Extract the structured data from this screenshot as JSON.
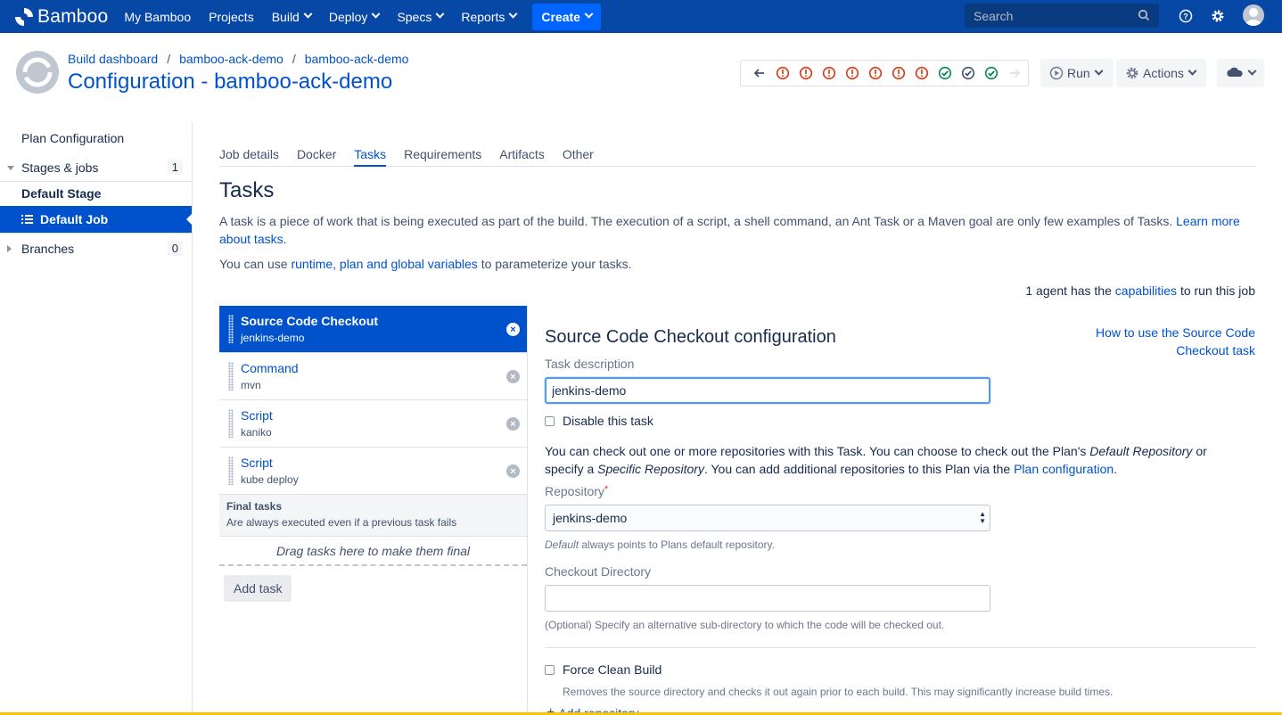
{
  "topnav": {
    "brand": "Bamboo",
    "items": [
      "My Bamboo",
      "Projects",
      "Build",
      "Deploy",
      "Specs",
      "Reports"
    ],
    "create_label": "Create",
    "search_placeholder": "Search",
    "bar_color": "#0747a6"
  },
  "header": {
    "breadcrumb": [
      "Build dashboard",
      "bamboo-ack-demo",
      "bamboo-ack-demo"
    ],
    "title": "Configuration - bamboo-ack-demo",
    "history": [
      "failed",
      "failed",
      "failed",
      "failed",
      "failed",
      "failed",
      "failed",
      "success",
      "success",
      "success"
    ],
    "run_label": "Run",
    "actions_label": "Actions"
  },
  "sidebar": {
    "plan_configuration": "Plan Configuration",
    "stages_label": "Stages & jobs",
    "stages_count": "1",
    "default_stage": "Default Stage",
    "default_job": "Default Job",
    "branches_label": "Branches",
    "branches_count": "0"
  },
  "tabs": [
    "Job details",
    "Docker",
    "Tasks",
    "Requirements",
    "Artifacts",
    "Other"
  ],
  "main": {
    "title": "Tasks",
    "intro": "A task is a piece of work that is being executed as part of the build. The execution of a script, a shell command, an Ant Task or a Maven goal are only few examples of Tasks.",
    "learn_more": "Learn more about tasks.",
    "vars_prefix": "You can use",
    "vars_link": "runtime, plan and global variables",
    "vars_suffix": "to parameterize your tasks.",
    "agent_prefix": "1 agent has the",
    "agent_link": "capabilities",
    "agent_suffix": "to run this job"
  },
  "tasks": [
    {
      "name": "Source Code Checkout",
      "desc": "jenkins-demo"
    },
    {
      "name": "Command",
      "desc": "mvn"
    },
    {
      "name": "Script",
      "desc": "kaniko"
    },
    {
      "name": "Script",
      "desc": "kube deploy"
    }
  ],
  "final_tasks": {
    "title": "Final tasks",
    "desc": "Are always executed even if a previous task fails",
    "drag": "Drag tasks here to make them final"
  },
  "add_task": "Add task",
  "config": {
    "title": "Source Code Checkout configuration",
    "howto": "How to use the Source Code Checkout task",
    "task_desc_label": "Task description",
    "task_desc_value": "jenkins-demo",
    "disable_label": "Disable this task",
    "para_1": "You can check out one or more repositories with this Task. You can choose to check out the Plan's",
    "para_em1": "Default Repository",
    "para_2": "or specify a",
    "para_em2": "Specific Repository",
    "para_3": ". You can add additional repositories to this Plan via the",
    "para_link": "Plan configuration",
    "para_end": ".",
    "repo_label": "Repository",
    "repo_value": "jenkins-demo",
    "repo_hint_em": "Default",
    "repo_hint": "always points to Plans default repository.",
    "checkout_label": "Checkout Directory",
    "checkout_value": "",
    "checkout_hint": "(Optional) Specify an alternative sub-directory to which the code will be checked out.",
    "force_label": "Force Clean Build",
    "force_hint": "Removes the source directory and checks it out again prior to each build. This may significantly increase build times.",
    "add_repo": "Add repository"
  }
}
